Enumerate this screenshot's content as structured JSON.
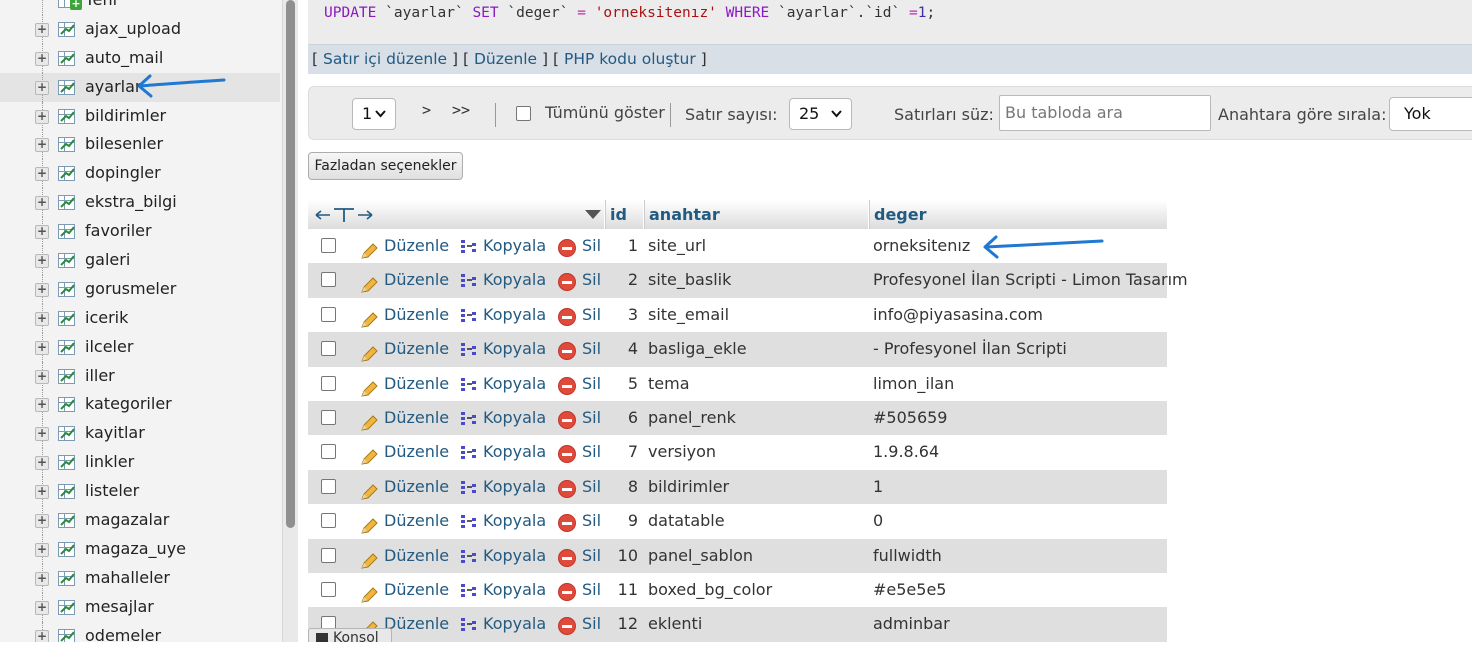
{
  "nav": {
    "tables": [
      {
        "name": "Yeni",
        "new": true
      },
      {
        "name": "ajax_upload"
      },
      {
        "name": "auto_mail"
      },
      {
        "name": "ayarlar",
        "active": true
      },
      {
        "name": "bildirimler"
      },
      {
        "name": "bilesenler"
      },
      {
        "name": "dopingler"
      },
      {
        "name": "ekstra_bilgi"
      },
      {
        "name": "favoriler"
      },
      {
        "name": "galeri"
      },
      {
        "name": "gorusmeler"
      },
      {
        "name": "icerik"
      },
      {
        "name": "ilceler"
      },
      {
        "name": "iller"
      },
      {
        "name": "kategoriler"
      },
      {
        "name": "kayitlar"
      },
      {
        "name": "linkler"
      },
      {
        "name": "listeler"
      },
      {
        "name": "magazalar"
      },
      {
        "name": "magaza_uye"
      },
      {
        "name": "mahalleler"
      },
      {
        "name": "mesajlar"
      },
      {
        "name": "odemeler"
      }
    ]
  },
  "sql": {
    "kw_update": "UPDATE",
    "table": "`ayarlar`",
    "kw_set": "SET",
    "column": "`deger`",
    "eq1": "=",
    "value": "'orneksitenız'",
    "kw_where": "WHERE",
    "cond": "`ayarlar`.`id`",
    "eq2": "=",
    "num": "1",
    "end": ";"
  },
  "sql_links": {
    "inline_edit": "Satır içi düzenle",
    "edit": "Düzenle",
    "php_code": "PHP kodu oluştur"
  },
  "toolbar": {
    "page_value": "1",
    "next": ">",
    "last": ">>",
    "show_all": "Tümünü göster",
    "rows_label": "Satır sayısı:",
    "rows_value": "25",
    "filter_label": "Satırları süz:",
    "filter_placeholder": "Bu tabloda ara",
    "sort_label": "Anahtara göre sırala:",
    "sort_value": "Yok"
  },
  "more_options": "Fazladan seçenekler",
  "table": {
    "columns": {
      "id": "id",
      "key": "anahtar",
      "value": "deger"
    },
    "actions": {
      "edit": "Düzenle",
      "copy": "Kopyala",
      "delete": "Sil"
    },
    "rows": [
      {
        "id": "1",
        "anahtar": "site_url",
        "deger": "orneksitenız"
      },
      {
        "id": "2",
        "anahtar": "site_baslik",
        "deger": "Profesyonel İlan Scripti - Limon Tasarım"
      },
      {
        "id": "3",
        "anahtar": "site_email",
        "deger": "info@piyasasina.com"
      },
      {
        "id": "4",
        "anahtar": "basliga_ekle",
        "deger": "- Profesyonel İlan Scripti"
      },
      {
        "id": "5",
        "anahtar": "tema",
        "deger": "limon_ilan"
      },
      {
        "id": "6",
        "anahtar": "panel_renk",
        "deger": "#505659"
      },
      {
        "id": "7",
        "anahtar": "versiyon",
        "deger": "1.9.8.64"
      },
      {
        "id": "8",
        "anahtar": "bildirimler",
        "deger": "1"
      },
      {
        "id": "9",
        "anahtar": "datatable",
        "deger": "0"
      },
      {
        "id": "10",
        "anahtar": "panel_sablon",
        "deger": "fullwidth"
      },
      {
        "id": "11",
        "anahtar": "boxed_bg_color",
        "deger": "#e5e5e5"
      },
      {
        "id": "12",
        "anahtar": "eklenti",
        "deger": "adminbar"
      }
    ]
  },
  "console": "Konsol",
  "colors": {
    "link": "#235a81",
    "annotation_arrow": "#1f78d1"
  }
}
